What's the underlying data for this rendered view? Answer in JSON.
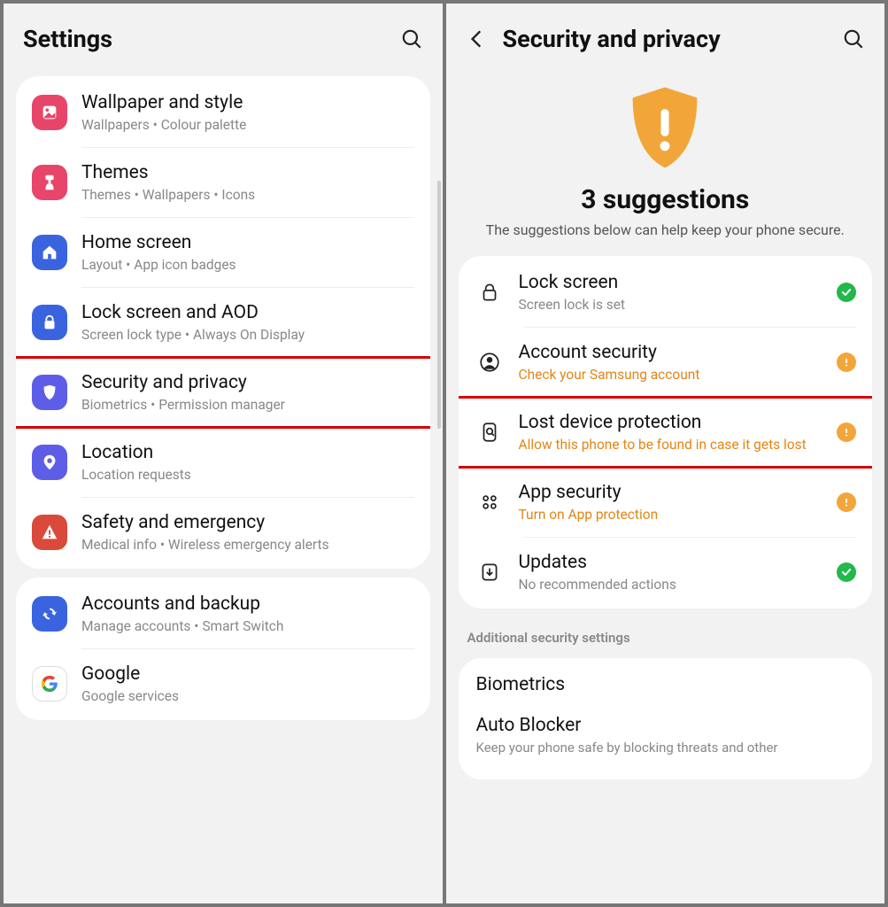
{
  "left": {
    "title": "Settings",
    "groups": [
      [
        {
          "id": "wallpaper",
          "title": "Wallpaper and style",
          "sub": "Wallpapers  •  Colour palette",
          "color": "#e8456a",
          "icon": "picture"
        },
        {
          "id": "themes",
          "title": "Themes",
          "sub": "Themes  •  Wallpapers  •  Icons",
          "color": "#e8456a",
          "icon": "brush"
        },
        {
          "id": "home",
          "title": "Home screen",
          "sub": "Layout  •  App icon badges",
          "color": "#3a63e0",
          "icon": "home"
        },
        {
          "id": "lockscreen",
          "title": "Lock screen and AOD",
          "sub": "Screen lock type  •  Always On Display",
          "color": "#3a63e0",
          "icon": "lock"
        },
        {
          "id": "security",
          "title": "Security and privacy",
          "sub": "Biometrics  •  Permission manager",
          "color": "#5d5de8",
          "icon": "shield",
          "highlight": true
        },
        {
          "id": "location",
          "title": "Location",
          "sub": "Location requests",
          "color": "#5d5de8",
          "icon": "pin"
        },
        {
          "id": "safety",
          "title": "Safety and emergency",
          "sub": "Medical info  •  Wireless emergency alerts",
          "color": "#d94a3a",
          "icon": "alert"
        }
      ],
      [
        {
          "id": "accounts",
          "title": "Accounts and backup",
          "sub": "Manage accounts  •  Smart Switch",
          "color": "#3a63e0",
          "icon": "sync"
        },
        {
          "id": "google",
          "title": "Google",
          "sub": "Google services",
          "color": "#ffffff",
          "icon": "google"
        }
      ]
    ]
  },
  "right": {
    "title": "Security and privacy",
    "hero_title": "3 suggestions",
    "hero_sub": "The suggestions below can help keep your phone secure.",
    "items": [
      {
        "id": "lock",
        "title": "Lock screen",
        "sub": "Screen lock is set",
        "warn": false,
        "status": "ok",
        "icon": "padlock"
      },
      {
        "id": "account",
        "title": "Account security",
        "sub": "Check your Samsung account",
        "warn": true,
        "status": "warn",
        "icon": "user"
      },
      {
        "id": "lost",
        "title": "Lost device protection",
        "sub": "Allow this phone to be found in case it gets lost",
        "warn": true,
        "status": "warn",
        "icon": "find",
        "highlight": true
      },
      {
        "id": "appsec",
        "title": "App security",
        "sub": "Turn on App protection",
        "warn": true,
        "status": "warn",
        "icon": "grid"
      },
      {
        "id": "updates",
        "title": "Updates",
        "sub": "No recommended actions",
        "warn": false,
        "status": "ok",
        "icon": "download"
      }
    ],
    "section_label": "Additional security settings",
    "extras": [
      {
        "id": "biometrics",
        "title": "Biometrics",
        "sub": ""
      },
      {
        "id": "autoblocker",
        "title": "Auto Blocker",
        "sub": "Keep your phone safe by blocking threats and other"
      }
    ]
  }
}
